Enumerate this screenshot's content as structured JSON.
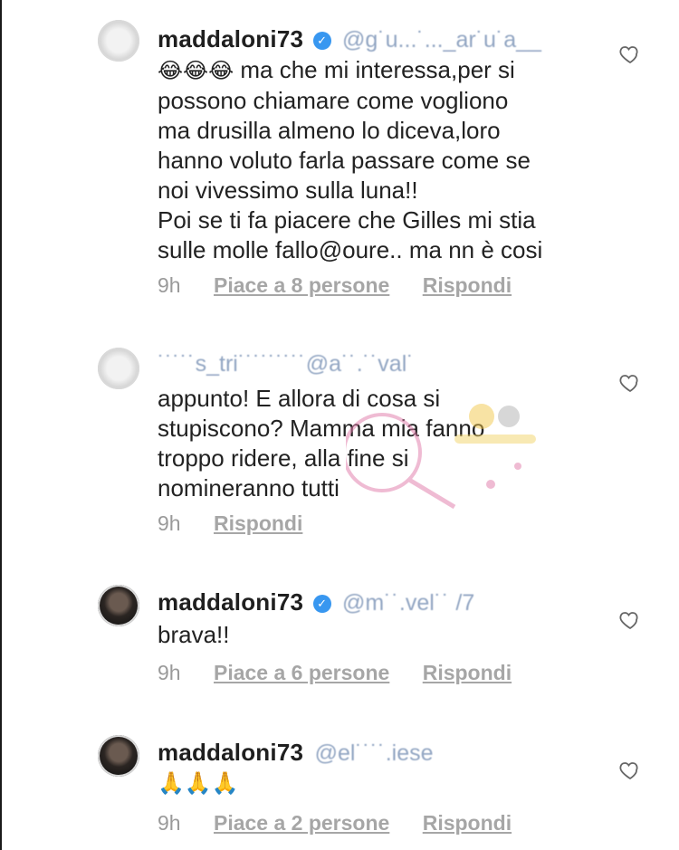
{
  "comments": [
    {
      "username": "maddaloni73",
      "verified": true,
      "mention": "@g˙u...˙..._ar˙u˙a__",
      "emoji": "😂😂😂",
      "lines": [
        "ma che mi interessa,per si",
        "possono chiamare come vogliono",
        "ma drusilla almeno lo diceva,loro",
        "hanno voluto farla passare come se",
        "noi vivessimo sulla luna!!",
        "Poi se ti fa piacere che Gilles mi stia",
        "sulle molle fallo@oure.. ma nn è cosi"
      ],
      "time": "9h",
      "likes": "Piace a 8 persone",
      "reply": "Rispondi"
    },
    {
      "username": "",
      "verified": false,
      "mention": "˙˙˙˙˙s_tri˙˙˙˙˙˙˙˙˙@a˙˙.˙˙val˙",
      "lines": [
        "appunto! E allora di cosa si",
        "stupiscono? Mamma mia fanno",
        "troppo ridere, alla fine si",
        "nomineranno tutti"
      ],
      "time": "9h",
      "likes": "",
      "reply": "Rispondi"
    },
    {
      "username": "maddaloni73",
      "verified": true,
      "mention": "@m˙˙.vel˙˙ /7",
      "lines": [
        "brava!!"
      ],
      "time": "9h",
      "likes": "Piace a 6 persone",
      "reply": "Rispondi"
    },
    {
      "username": "maddaloni73",
      "verified": true,
      "mention": "@el˙˙˙˙.iese",
      "lines": [
        "🙏🙏🙏"
      ],
      "time": "9h",
      "likes": "Piace a 2 persone",
      "reply": "Rispondi"
    }
  ],
  "icons": {
    "heart": "heart-outline-icon",
    "verified": "verified-badge-icon"
  },
  "colors": {
    "verified": "#3897f0",
    "meta": "#9a9a9a",
    "text": "#222222"
  }
}
